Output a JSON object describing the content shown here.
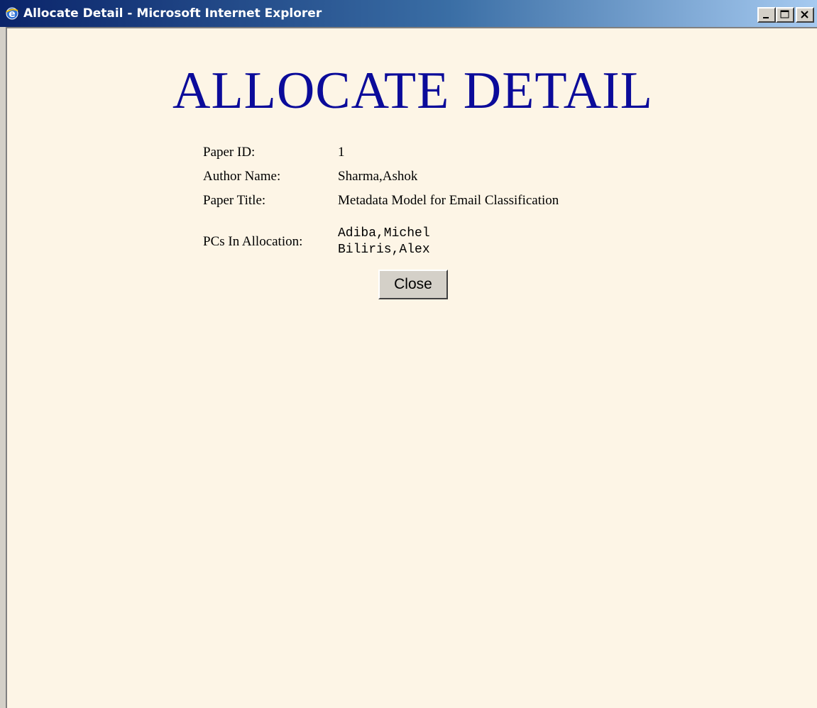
{
  "window": {
    "title": "Allocate Detail - Microsoft Internet Explorer",
    "icon": "ie-icon",
    "controls": {
      "minimize": "minimize-icon",
      "maximize": "maximize-icon",
      "close": "close-icon"
    }
  },
  "page": {
    "heading": "ALLOCATE DETAIL",
    "heading_color": "#0b0b9a",
    "background_color": "#fdf5e6"
  },
  "details": {
    "paper_id_label": "Paper ID:",
    "paper_id_value": "1",
    "author_label": "Author Name:",
    "author_value": "Sharma,Ashok",
    "title_label": "Paper Title:",
    "title_value": "Metadata Model for Email Classification",
    "pcs_label": "PCs In Allocation:",
    "pcs": [
      "Adiba,Michel",
      "Biliris,Alex"
    ]
  },
  "actions": {
    "close_label": "Close"
  }
}
